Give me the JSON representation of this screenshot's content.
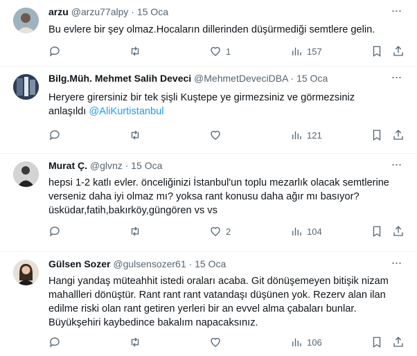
{
  "tweets": [
    {
      "name": "arzu",
      "handle": "@arzu77alpy",
      "dot": "·",
      "date": "15 Oca",
      "text": "Bu evlere bir şey olmaz.Hocaların dillerinden düşürmediği semtlere gelin.",
      "mention": "",
      "reply_count": "",
      "retweet_count": "",
      "like_count": "1",
      "view_count": "157",
      "avatar_color": "#b8c6cf"
    },
    {
      "name": "Bilg.Müh. Mehmet Salih Deveci",
      "handle": "@MehmetDeveciDBA",
      "dot": "·",
      "date": "15 Oca",
      "text": "Heryere girersiniz bir tek şişli Kuştepe ye girmezsiniz ve görmezsiniz anlaşıldı",
      "mention": "@AliKurtistanbul",
      "reply_count": "",
      "retweet_count": "",
      "like_count": "",
      "view_count": "121",
      "avatar_color": "#2c3e57"
    },
    {
      "name": "Murat Ç.",
      "handle": "@glvnz",
      "dot": "·",
      "date": "15 Oca",
      "text": "hepsi 1-2 katlı evler. önceliğinizi İstanbul'un toplu mezarlık olacak semtlerine verseniz daha iyi olmaz mı? yoksa rant konusu daha ağır mı basıyor? üsküdar,fatih,bakırköy,güngören  vs vs",
      "mention": "",
      "reply_count": "",
      "retweet_count": "",
      "like_count": "2",
      "view_count": "104",
      "avatar_color": "#c9c9c9"
    },
    {
      "name": "Gülsen Sozer",
      "handle": "@gulsensozer61",
      "dot": "·",
      "date": "15 Oca",
      "text": "Hangi yandaş müteahhit istedi oraları acaba.  Git dönüşemeyen bitişik nizam mahallleri dönüştür. Rant rant rant vatandaşı düşünen yok. Rezerv alan ilan edilme riski olan rant getiren yerleri bir an evvel alma çabaları bunlar. Büyükşehiri kaybedince bakalım napacaksınız.",
      "mention": "",
      "reply_count": "",
      "retweet_count": "",
      "like_count": "",
      "view_count": "106",
      "avatar_color": "#d9d2c8"
    }
  ],
  "icons": {
    "more": "more-icon",
    "reply": "reply-icon",
    "retweet": "retweet-icon",
    "like": "like-icon",
    "views": "views-icon",
    "bookmark": "bookmark-icon",
    "share": "share-icon"
  },
  "colors": {
    "text": "#0f1419",
    "secondary": "#536471",
    "link": "#1d9bf0",
    "divider": "#eff3f4"
  }
}
